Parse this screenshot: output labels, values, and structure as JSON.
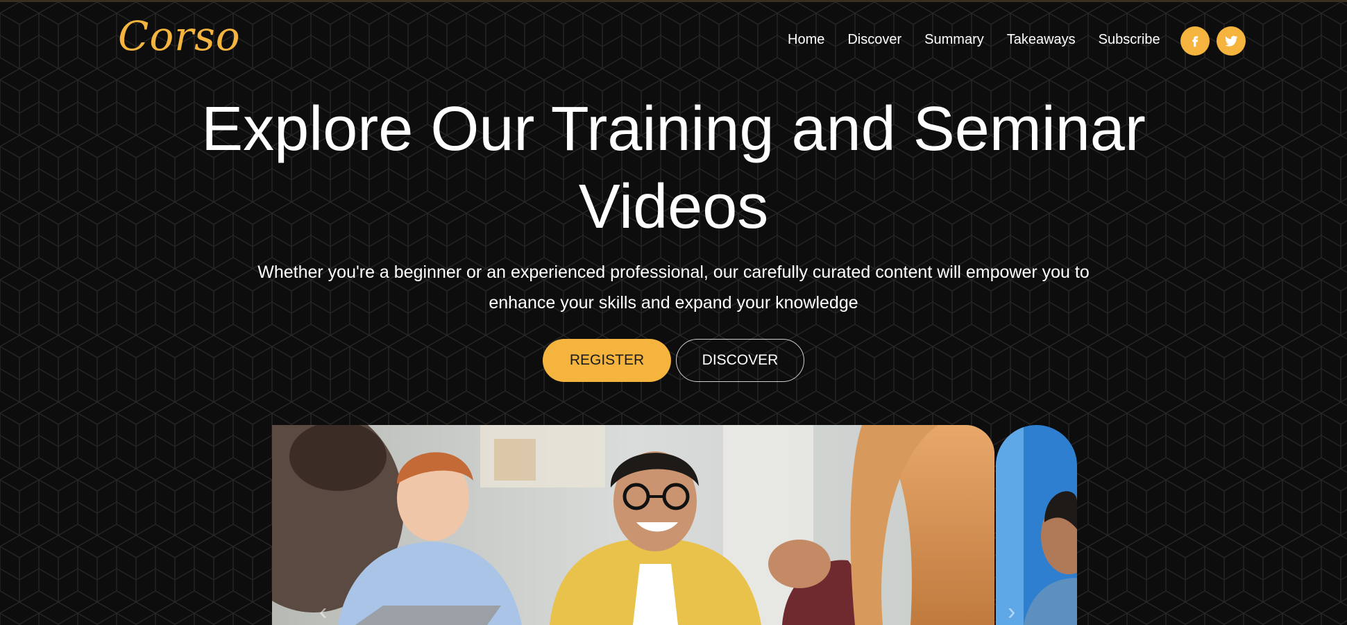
{
  "brand": {
    "logo_text": "Corso"
  },
  "nav": {
    "items": [
      {
        "label": "Home"
      },
      {
        "label": "Discover"
      },
      {
        "label": "Summary"
      },
      {
        "label": "Takeaways"
      },
      {
        "label": "Subscribe"
      }
    ],
    "social": [
      {
        "icon": "facebook-icon"
      },
      {
        "icon": "twitter-icon"
      }
    ]
  },
  "hero": {
    "title_line1": "Explore Our Training and Seminar",
    "title_line2": "Videos",
    "subtitle_line1": "Whether you're a beginner or an experienced professional, our carefully curated content will empower you to",
    "subtitle_line2": "enhance your skills and expand your knowledge",
    "primary_button": "REGISTER",
    "secondary_button": "DISCOVER"
  },
  "carousel": {
    "prev_icon": "chevron-left-icon",
    "next_icon": "chevron-right-icon"
  },
  "colors": {
    "accent": "#f4b43e",
    "background": "#0d0d0d",
    "text": "#ffffff"
  }
}
